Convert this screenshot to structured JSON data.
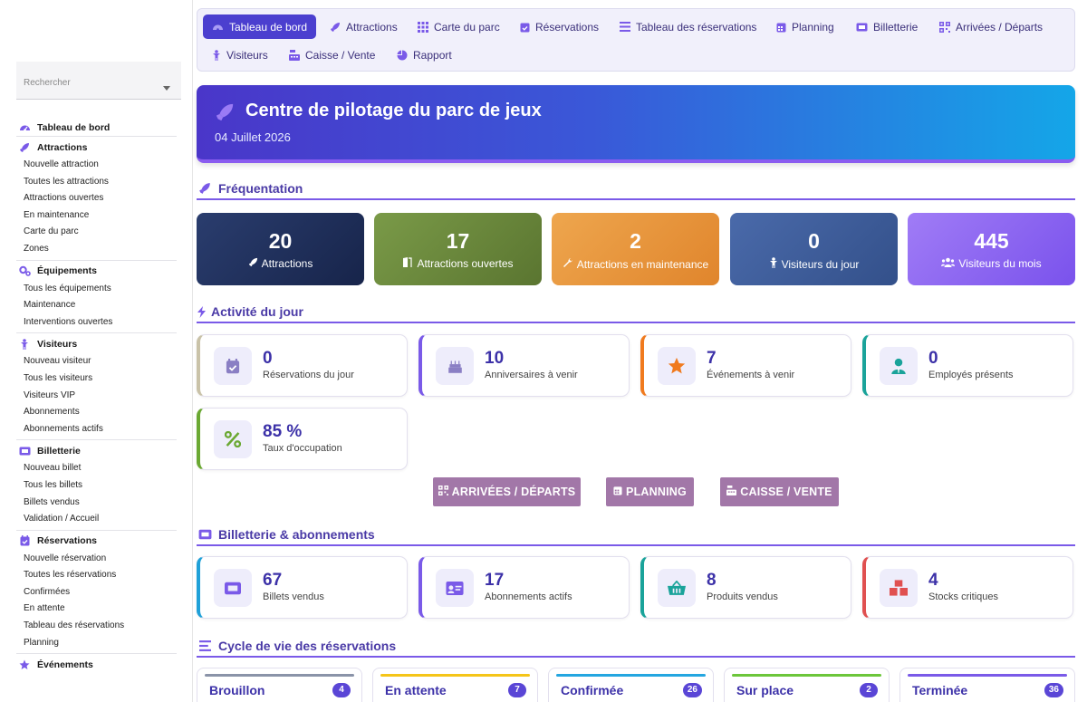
{
  "sidebar": {
    "search_placeholder": "Rechercher",
    "groups": [
      {
        "title": "Tableau de bord",
        "icon": "gauge-icon",
        "items": []
      },
      {
        "title": "Attractions",
        "icon": "rocket-icon",
        "items": [
          "Nouvelle attraction",
          "Toutes les attractions",
          "Attractions ouvertes",
          "En maintenance",
          "Carte du parc",
          "Zones"
        ]
      },
      {
        "title": "Équipements",
        "icon": "gears-icon",
        "items": [
          "Tous les équipements",
          "Maintenance",
          "Interventions ouvertes"
        ]
      },
      {
        "title": "Visiteurs",
        "icon": "child-icon",
        "items": [
          "Nouveau visiteur",
          "Tous les visiteurs",
          "Visiteurs VIP",
          "Abonnements",
          "Abonnements actifs"
        ]
      },
      {
        "title": "Billetterie",
        "icon": "ticket-icon",
        "items": [
          "Nouveau billet",
          "Tous les billets",
          "Billets vendus",
          "Validation / Accueil"
        ]
      },
      {
        "title": "Réservations",
        "icon": "calendar-check-icon",
        "items": [
          "Nouvelle réservation",
          "Toutes les réservations",
          "Confirmées",
          "En attente",
          "Tableau des réservations",
          "Planning"
        ]
      },
      {
        "title": "Événements",
        "icon": "star-icon",
        "items": []
      }
    ]
  },
  "topnav": {
    "tabs": [
      {
        "label": "Tableau de bord",
        "icon": "gauge-icon",
        "active": true
      },
      {
        "label": "Attractions",
        "icon": "rocket-icon"
      },
      {
        "label": "Carte du parc",
        "icon": "grid-icon"
      },
      {
        "label": "Réservations",
        "icon": "calendar-check-icon"
      },
      {
        "label": "Tableau des réservations",
        "icon": "list-icon"
      },
      {
        "label": "Planning",
        "icon": "calendar-icon"
      },
      {
        "label": "Billetterie",
        "icon": "ticket-icon"
      },
      {
        "label": "Arrivées / Départs",
        "icon": "qrcode-icon"
      },
      {
        "label": "Visiteurs",
        "icon": "child-icon"
      },
      {
        "label": "Caisse / Vente",
        "icon": "cash-register-icon"
      },
      {
        "label": "Rapport",
        "icon": "pie-chart-icon"
      }
    ]
  },
  "hero": {
    "title": "Centre de pilotage du parc de jeux",
    "date": "04 Juillet 2026"
  },
  "sections": {
    "frequentation": "Fréquentation",
    "activite": "Activité du jour",
    "billetterie": "Billetterie & abonnements",
    "cycle": "Cycle de vie des réservations"
  },
  "stats": [
    {
      "value": "20",
      "label": "Attractions",
      "icon": "rocket-icon"
    },
    {
      "value": "17",
      "label": "Attractions ouvertes",
      "icon": "door-open-icon"
    },
    {
      "value": "2",
      "label": "Attractions en maintenance",
      "icon": "wrench-icon"
    },
    {
      "value": "0",
      "label": "Visiteurs du jour",
      "icon": "child-icon"
    },
    {
      "value": "445",
      "label": "Visiteurs du mois",
      "icon": "users-icon"
    }
  ],
  "activity": [
    {
      "value": "0",
      "label": "Réservations du jour",
      "icon": "calendar-check-icon",
      "accent": "#c9c2a8"
    },
    {
      "value": "10",
      "label": "Anniversaires à venir",
      "icon": "birthday-cake-icon",
      "accent": "#7a5ae8"
    },
    {
      "value": "7",
      "label": "Événements à venir",
      "icon": "star-icon",
      "accent": "#f07a1e"
    },
    {
      "value": "0",
      "label": "Employés présents",
      "icon": "user-tie-icon",
      "accent": "#1aa39a"
    },
    {
      "value": "85 %",
      "label": "Taux d'occupation",
      "icon": "percent-icon",
      "accent": "#6aa832"
    }
  ],
  "quick_buttons": [
    {
      "label": "ARRIVÉES / DÉPARTS",
      "icon": "qrcode-icon"
    },
    {
      "label": "PLANNING",
      "icon": "calendar-icon"
    },
    {
      "label": "CAISSE / VENTE",
      "icon": "cash-register-icon"
    }
  ],
  "ticketing": [
    {
      "value": "67",
      "label": "Billets vendus",
      "icon": "ticket-icon",
      "accent": "#1fa0d8"
    },
    {
      "value": "17",
      "label": "Abonnements actifs",
      "icon": "id-card-icon",
      "accent": "#7a5ae8"
    },
    {
      "value": "8",
      "label": "Produits vendus",
      "icon": "basket-icon",
      "accent": "#1aa39a"
    },
    {
      "value": "4",
      "label": "Stocks critiques",
      "icon": "boxes-icon",
      "accent": "#e05050"
    }
  ],
  "lifecycle": [
    {
      "label": "Brouillon",
      "count": "4",
      "color": "#8a93a8"
    },
    {
      "label": "En attente",
      "count": "7",
      "color": "#f5c518"
    },
    {
      "label": "Confirmée",
      "count": "26",
      "color": "#24a6e0"
    },
    {
      "label": "Sur place",
      "count": "2",
      "color": "#6cc63a"
    },
    {
      "label": "Terminée",
      "count": "36",
      "color": "#7a5ae8"
    }
  ],
  "colors": {
    "primary": "#4b3fcf",
    "section_text": "#4a3aa6",
    "tile_1": "#1f2d55",
    "tile_2": "#6a8a3c",
    "tile_3": "#e8923c",
    "tile_4": "#3c5a96",
    "tile_5": "#8a62f2",
    "quick_button": "#a277a8"
  }
}
